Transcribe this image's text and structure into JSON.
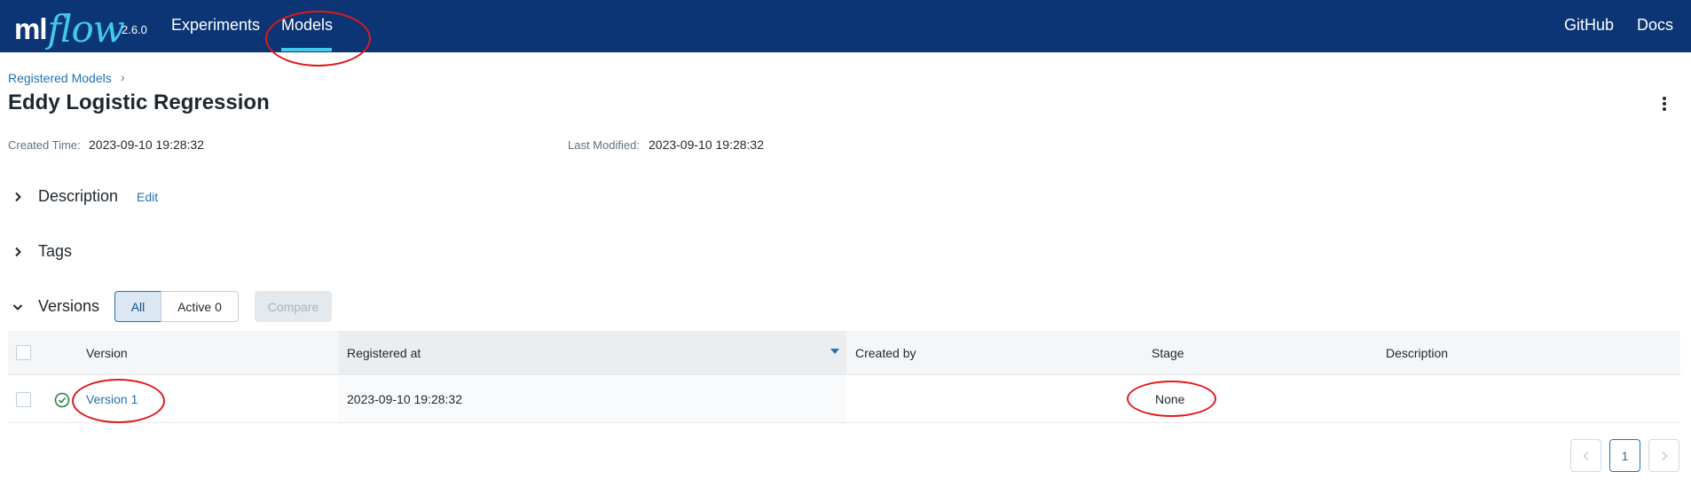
{
  "header": {
    "logo_ml": "ml",
    "logo_flow": "flow",
    "version": "2.6.0",
    "nav": {
      "experiments": "Experiments",
      "models": "Models",
      "github": "GitHub",
      "docs": "Docs"
    }
  },
  "breadcrumb": {
    "label": "Registered Models",
    "separator": "›"
  },
  "page": {
    "title": "Eddy Logistic Regression",
    "created_label": "Created Time:",
    "created_value": "2023-09-10 19:28:32",
    "modified_label": "Last Modified:",
    "modified_value": "2023-09-10 19:28:32"
  },
  "sections": {
    "description": "Description",
    "edit": "Edit",
    "tags": "Tags",
    "versions": "Versions"
  },
  "filters": {
    "all": "All",
    "active": "Active 0",
    "compare": "Compare"
  },
  "table": {
    "headers": {
      "version": "Version",
      "registered_at": "Registered at",
      "created_by": "Created by",
      "stage": "Stage",
      "description": "Description"
    },
    "rows": [
      {
        "version": "Version 1",
        "registered_at": "2023-09-10 19:28:32",
        "created_by": "",
        "stage": "None",
        "description": ""
      }
    ]
  },
  "pagination": {
    "current": "1"
  },
  "colors": {
    "header_bg": "#0b3574",
    "accent": "#43c9ed",
    "link": "#2272b4",
    "annotation": "#e0191c"
  },
  "icons": [
    "kebab-menu-icon",
    "chevron-right-icon",
    "chevron-down-icon",
    "check-circle-icon",
    "sort-desc-icon"
  ]
}
